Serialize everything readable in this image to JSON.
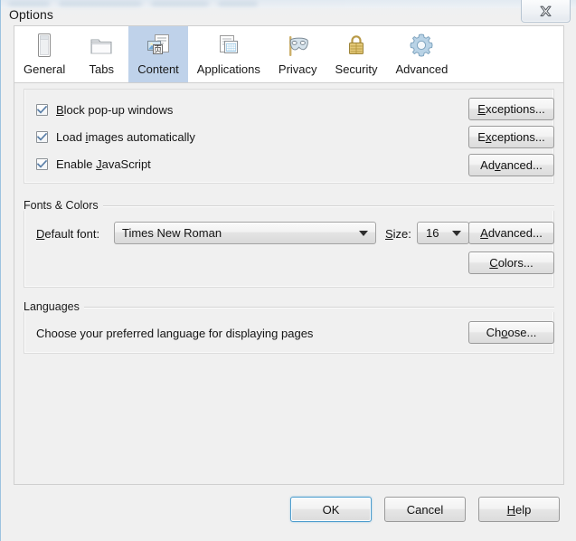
{
  "window": {
    "title": "Options",
    "close_label": "Close",
    "close_icon": "close-x-icon"
  },
  "tabs": [
    {
      "label": "General",
      "icon": "window-pane-icon",
      "selected": false
    },
    {
      "label": "Tabs",
      "icon": "folder-tabs-icon",
      "selected": false
    },
    {
      "label": "Content",
      "icon": "content-page-icon",
      "selected": true
    },
    {
      "label": "Applications",
      "icon": "applications-icon",
      "selected": false
    },
    {
      "label": "Privacy",
      "icon": "privacy-mask-icon",
      "selected": false
    },
    {
      "label": "Security",
      "icon": "padlock-icon",
      "selected": false
    },
    {
      "label": "Advanced",
      "icon": "gear-icon",
      "selected": false
    }
  ],
  "content": {
    "checkboxes": [
      {
        "label": "Block pop-up windows",
        "accesskey": "B",
        "checked": true
      },
      {
        "label": "Load images automatically",
        "accesskey": "i",
        "checked": true
      },
      {
        "label": "Enable JavaScript",
        "accesskey": "J",
        "checked": true
      }
    ],
    "checkbox_buttons": [
      {
        "label": "Exceptions...",
        "accesskey": "E"
      },
      {
        "label": "Exceptions...",
        "accesskey": "x"
      },
      {
        "label": "Advanced...",
        "accesskey": "v"
      }
    ],
    "fonts_colors": {
      "group_label": "Fonts & Colors",
      "default_font_label": "Default font:",
      "default_font_accesskey": "D",
      "default_font_value": "Times New Roman",
      "size_label": "Size:",
      "size_accesskey": "S",
      "size_value": "16",
      "advanced_button": {
        "label": "Advanced...",
        "accesskey": "A"
      },
      "colors_button": {
        "label": "Colors...",
        "accesskey": "C"
      }
    },
    "languages": {
      "group_label": "Languages",
      "description": "Choose your preferred language for displaying pages",
      "choose_button": {
        "label": "Choose...",
        "accesskey": "o"
      }
    }
  },
  "footer": {
    "ok": {
      "label": "OK",
      "default": true
    },
    "cancel": {
      "label": "Cancel",
      "default": false
    },
    "help": {
      "label": "Help",
      "accesskey": "H",
      "default": false
    }
  },
  "colors": {
    "dialog_background": "#f0f0f0",
    "panel_background": "#f0f0f0",
    "tabstrip_background": "#ffffff",
    "selected_tab": "#bfd2ea",
    "default_button_border": "#4b9ccd",
    "text": "#141414",
    "group_rule": "#d4d4d4"
  }
}
